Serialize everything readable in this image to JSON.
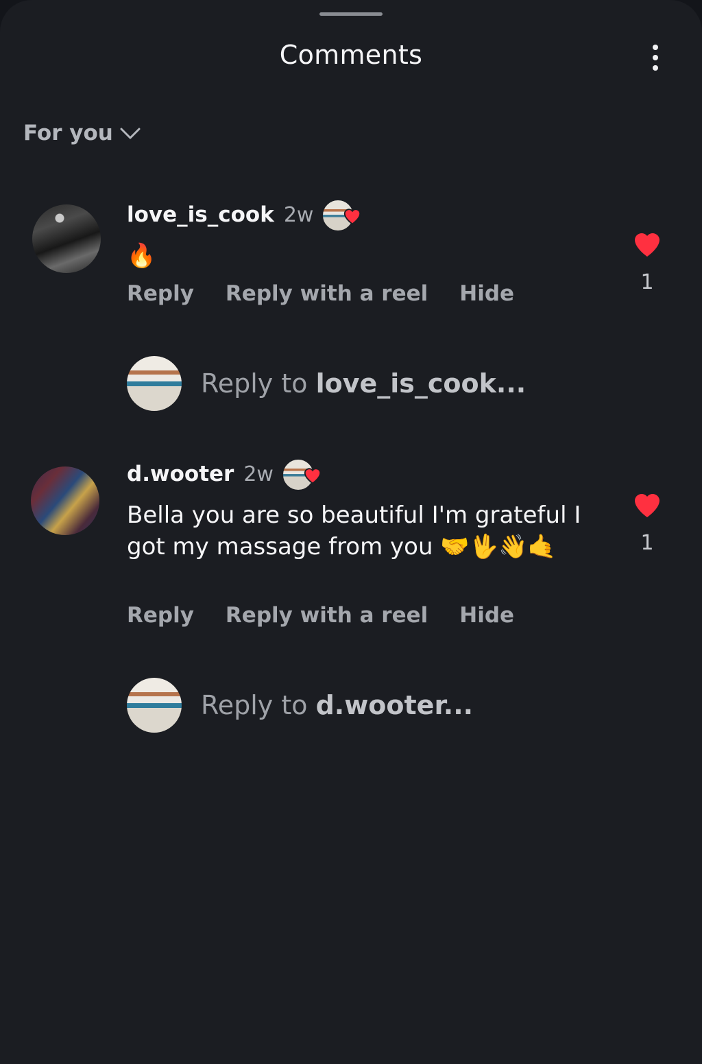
{
  "header": {
    "title": "Comments",
    "filter_label": "For you"
  },
  "comments": [
    {
      "username": "love_is_cook",
      "time": "2w",
      "text": "🔥",
      "actions": {
        "reply": "Reply",
        "reply_reel": "Reply with a reel",
        "hide": "Hide"
      },
      "like_count": "1",
      "reply_placeholder_prefix": "Reply to ",
      "reply_placeholder_name": "love_is_cook..."
    },
    {
      "username": "d.wooter",
      "time": "2w",
      "text": "Bella you are so beautiful I'm grateful I got my massage from you 🤝🖖👋🤙",
      "actions": {
        "reply": "Reply",
        "reply_reel": "Reply with a reel",
        "hide": "Hide"
      },
      "like_count": "1",
      "reply_placeholder_prefix": "Reply to ",
      "reply_placeholder_name": "d.wooter..."
    }
  ],
  "colors": {
    "background": "#1b1d22",
    "heart": "#ff3040",
    "muted_text": "#a4a7ad"
  },
  "icons": [
    "more-options-icon",
    "chevron-down-icon",
    "heart-icon",
    "creator-liked-heart-icon"
  ]
}
